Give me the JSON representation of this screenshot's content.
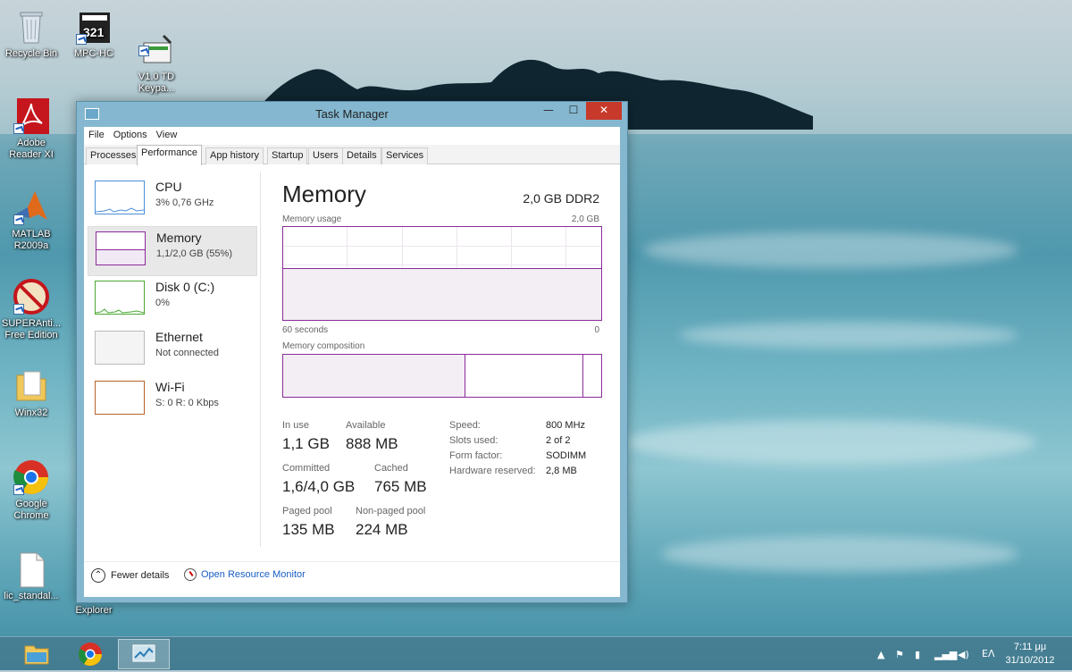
{
  "desktop": {
    "icons": [
      {
        "label": "Recycle Bin",
        "icon": "recycle-bin-icon"
      },
      {
        "label": "MPC-HC",
        "icon": "mpc-hc-icon"
      },
      {
        "label": "V1.0 TD\nKeypa...",
        "icon": "keypad-app-icon"
      },
      {
        "label": "Adobe\nReader XI",
        "icon": "pdf-icon"
      },
      {
        "label": "MATLAB\nR2009a",
        "icon": "matlab-icon"
      },
      {
        "label": "SUPERAnti...\nFree Edition",
        "icon": "no-entry-icon"
      },
      {
        "label": "Winx32",
        "icon": "folder-icon"
      },
      {
        "label": "Google\nChrome",
        "icon": "chrome-icon"
      },
      {
        "label": "lic_standal...",
        "icon": "document-icon"
      }
    ]
  },
  "window": {
    "title": "Task Manager",
    "controls": {
      "minimize": "—",
      "maximize": "☐",
      "close": "✕"
    },
    "menu": [
      "File",
      "Options",
      "View"
    ],
    "tabs": [
      {
        "label": "Processes",
        "active": false
      },
      {
        "label": "Performance",
        "active": true
      },
      {
        "label": "App history",
        "active": false
      },
      {
        "label": "Startup",
        "active": false
      },
      {
        "label": "Users",
        "active": false
      },
      {
        "label": "Details",
        "active": false
      },
      {
        "label": "Services",
        "active": false
      }
    ],
    "resources": [
      {
        "name": "CPU",
        "sub": "3% 0,76 GHz",
        "color": "#4a90d9",
        "selected": false
      },
      {
        "name": "Memory",
        "sub": "1,1/2,0 GB (55%)",
        "color": "#8b2b9a",
        "selected": true
      },
      {
        "name": "Disk 0 (C:)",
        "sub": "0%",
        "color": "#4aa832",
        "selected": false
      },
      {
        "name": "Ethernet",
        "sub": "Not connected",
        "color": "#bbbbbb",
        "selected": false
      },
      {
        "name": "Wi-Fi",
        "sub": "S: 0 R: 0 Kbps",
        "color": "#b7632a",
        "selected": false
      }
    ],
    "memory": {
      "title": "Memory",
      "spec": "2,0 GB DDR2",
      "usage_label": "Memory usage",
      "usage_max": "2,0 GB",
      "time_left": "60 seconds",
      "time_right": "0",
      "usage_fraction": 0.55,
      "composition_label": "Memory composition",
      "in_use_label": "In use",
      "in_use": "1,1 GB",
      "available_label": "Available",
      "available": "888 MB",
      "committed_label": "Committed",
      "committed": "1,6/4,0 GB",
      "cached_label": "Cached",
      "cached": "765 MB",
      "paged_label": "Paged pool",
      "paged": "135 MB",
      "nonpaged_label": "Non-paged pool",
      "nonpaged": "224 MB",
      "details": [
        {
          "k": "Speed:",
          "v": "800 MHz"
        },
        {
          "k": "Slots used:",
          "v": "2 of 2"
        },
        {
          "k": "Form factor:",
          "v": "SODIMM"
        },
        {
          "k": "Hardware reserved:",
          "v": "2,8 MB"
        }
      ]
    },
    "footer": {
      "fewer_details": "Fewer details",
      "open_resource_monitor": "Open Resource Monitor"
    }
  },
  "partial_labels": {
    "explorer": "Explorer"
  },
  "taskbar": {
    "language": "ΕΛ",
    "time": "7:11 μμ",
    "date": "31/10/2012"
  }
}
